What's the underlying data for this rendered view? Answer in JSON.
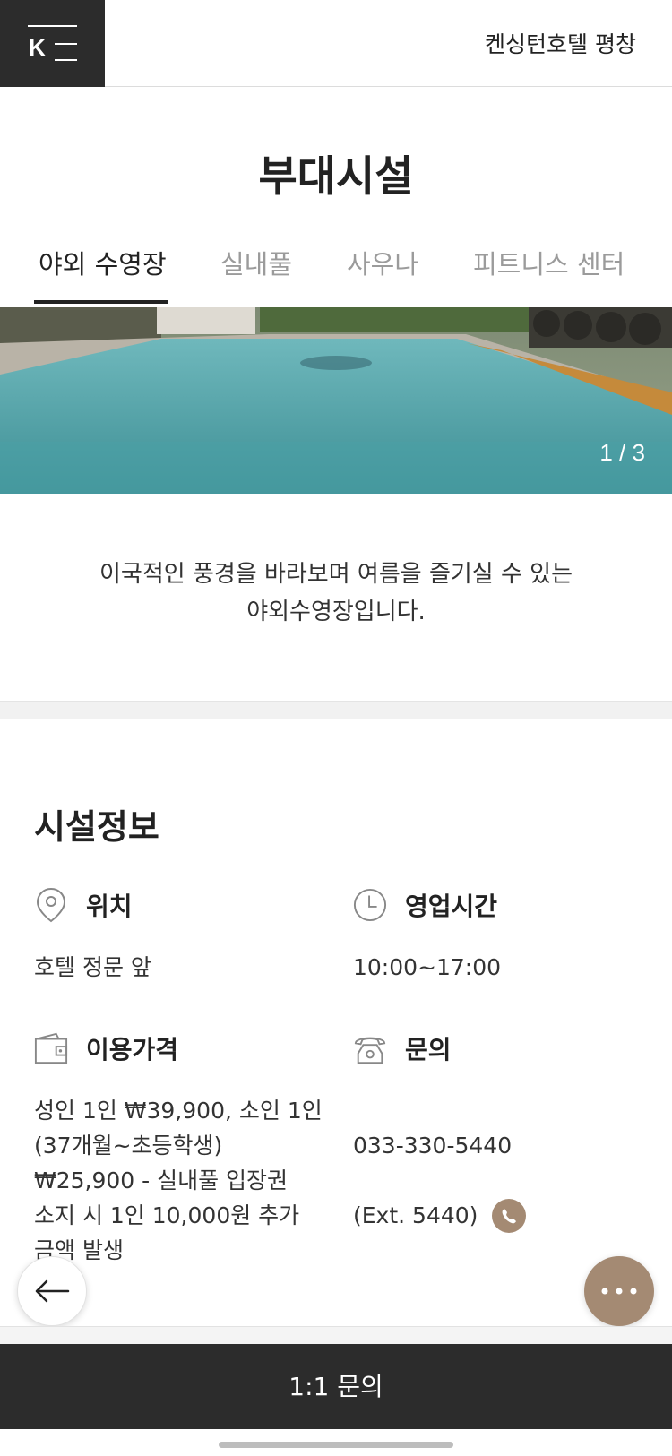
{
  "header": {
    "logo_letter": "K",
    "hotel_name": "켄싱턴호텔 평창"
  },
  "page": {
    "title": "부대시설"
  },
  "tabs": [
    {
      "label": "야외 수영장",
      "active": true
    },
    {
      "label": "실내풀",
      "active": false
    },
    {
      "label": "사우나",
      "active": false
    },
    {
      "label": "피트니스 센터",
      "active": false
    }
  ],
  "gallery": {
    "counter": "1 / 3"
  },
  "description": {
    "line1": "이국적인 풍경을 바라보며 여름을 즐기실 수 있는",
    "line2": "야외수영장입니다."
  },
  "facility_info": {
    "title": "시설정보",
    "location": {
      "label": "위치",
      "value": "호텔 정문 앞",
      "icon": "map-pin-icon"
    },
    "hours": {
      "label": "영업시간",
      "value": "10:00~17:00",
      "icon": "clock-icon"
    },
    "price": {
      "label": "이용가격",
      "value": "성인 1인 ₩39,900, 소인 1인\n(37개월~초등학생)\n₩25,900 - 실내풀 입장권\n소지 시 1인 10,000원 추가\n금액 발생",
      "icon": "wallet-icon"
    },
    "contact": {
      "label": "문의",
      "phone": "033-330-5440",
      "ext": "(Ext. 5440)",
      "icon": "telephone-icon"
    }
  },
  "bottom_bar": {
    "inquiry_label": "1:1 문의"
  },
  "colors": {
    "dark": "#2c2c2c",
    "accent": "#a48a73",
    "muted_tab": "#9b9b9b"
  }
}
